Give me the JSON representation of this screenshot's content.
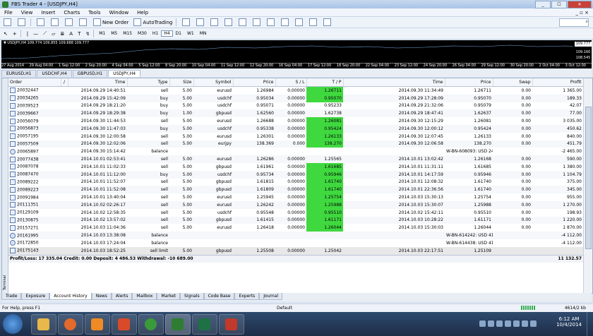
{
  "window": {
    "title": "FBS Trader 4 - [USDJPY,H4]",
    "controls": [
      "_",
      "☐",
      "✕"
    ]
  },
  "menu": {
    "items": [
      "File",
      "View",
      "Insert",
      "Charts",
      "Tools",
      "Window",
      "Help"
    ],
    "mdi_controls": "_ ▫ ×"
  },
  "toolbar1": {
    "new_order": "New Order",
    "autotrading": "AutoTrading"
  },
  "toolbar2": {
    "timeframes": [
      "M1",
      "M5",
      "M15",
      "M30",
      "H1",
      "H4",
      "D1",
      "W1",
      "MN"
    ],
    "active": "H4"
  },
  "search": {
    "icon": "search-icon"
  },
  "chart": {
    "header": "▼ USDJPY,H4  109.774  109.855  109.688  109.777",
    "price_top": "109.777",
    "price_mid": "109.160",
    "price_low": "108.545",
    "dates": [
      "27 Aug 2014",
      "29 Aug 04:00",
      "1 Sep 12:00",
      "2 Sep 20:00",
      "4 Sep 04:00",
      "5 Sep 12:00",
      "8 Sep 20:00",
      "10 Sep 04:00",
      "11 Sep 12:00",
      "12 Sep 20:00",
      "16 Sep 04:00",
      "17 Sep 12:00",
      "18 Sep 20:00",
      "22 Sep 04:00",
      "23 Sep 12:00",
      "24 Sep 20:00",
      "26 Sep 04:00",
      "29 Sep 12:00",
      "30 Sep 20:00",
      "2 Oct 04:00",
      "3 Oct 12:00"
    ]
  },
  "chart_tabs": [
    "EURUSD,H1",
    "USDCHF,H4",
    "GBPUSD,H1",
    "USDJPY,H4"
  ],
  "chart_tabs_active": 3,
  "table": {
    "headers": [
      "Order",
      "/",
      "Time",
      "Type",
      "Size",
      "Symbol",
      "Price",
      "S / L",
      "T / P",
      "Time",
      "Price",
      "Swap",
      "Profit"
    ],
    "rows": [
      [
        "20032447",
        "2014.09.29 14:40:51",
        "sell",
        "5.00",
        "eurusd",
        "1.26984",
        "0.00000",
        "1.26711",
        "2014.09.30 11:34:49",
        "1.26711",
        "0.00",
        "1 365.00",
        "tp"
      ],
      [
        "20034265",
        "2014.09.29 15:42:09",
        "buy",
        "5.00",
        "usdchf",
        "0.95034",
        "0.00000",
        "0.95070",
        "2014.09.29 17:28:09",
        "0.95070",
        "0.00",
        "189.33",
        "tp"
      ],
      [
        "20039523",
        "2014.09.29 18:21:20",
        "buy",
        "5.00",
        "usdchf",
        "0.95071",
        "0.00000",
        "0.95233",
        "2014.09.29 21:32:06",
        "0.95079",
        "0.00",
        "42.07",
        ""
      ],
      [
        "20039667",
        "2014.09.29 18:29:38",
        "buy",
        "1.00",
        "gbpusd",
        "1.62560",
        "0.00000",
        "1.62738",
        "2014.09.29 18:47:41",
        "1.62637",
        "0.00",
        "77.00",
        ""
      ],
      [
        "20056079",
        "2014.09.30 11:44:53",
        "sell",
        "5.00",
        "eurusd",
        "1.26688",
        "0.00000",
        "1.26081",
        "2014.09.30 12:15:29",
        "1.26081",
        "0.00",
        "3 035.00",
        "tp"
      ],
      [
        "20056873",
        "2014.09.30 11:47:03",
        "buy",
        "5.00",
        "usdchf",
        "0.95338",
        "0.00000",
        "0.95424",
        "2014.09.30 12:00:12",
        "0.95424",
        "0.00",
        "450.62",
        "tp"
      ],
      [
        "20057195",
        "2014.09.30 12:00:58",
        "sell",
        "5.00",
        "eurusd",
        "1.26301",
        "0.00000",
        "1.26133",
        "2014.09.30 12:07:45",
        "1.26133",
        "0.00",
        "840.00",
        "tp"
      ],
      [
        "20057509",
        "2014.09.30 12:02:06",
        "sell",
        "5.00",
        "eurjpy",
        "138.369",
        "0.000",
        "138.270",
        "2014.09.30 12:06:58",
        "138.270",
        "0.00",
        "451.79",
        "tp"
      ],
      [
        "20065897",
        "2014.09.30 15:14:42",
        "balance",
        "",
        "",
        "",
        "",
        "",
        "",
        "W-BN-608093: USD 24.65",
        "",
        "-2 465.00",
        "bal"
      ],
      [
        "20077438",
        "2014.10.01 02:53:41",
        "sell",
        "5.00",
        "eurusd",
        "1.26286",
        "0.00000",
        "1.25565",
        "2014.10.01 13:02:42",
        "1.26168",
        "0.00",
        "590.00",
        ""
      ],
      [
        "20087078",
        "2014.10.01 11:02:33",
        "sell",
        "5.00",
        "gbpusd",
        "1.61961",
        "0.00000",
        "1.61685",
        "2014.10.01 11:31:11",
        "1.61685",
        "0.00",
        "1 380.00",
        "tp"
      ],
      [
        "20087470",
        "2014.10.01 11:12:00",
        "buy",
        "5.00",
        "usdchf",
        "0.95734",
        "0.00000",
        "0.95946",
        "2014.10.01 14:17:59",
        "0.95946",
        "0.00",
        "1 104.79",
        "tp"
      ],
      [
        "20089222",
        "2014.10.01 11:52:07",
        "sell",
        "5.00",
        "gbpusd",
        "1.61815",
        "0.00000",
        "1.61740",
        "2014.10.01 12:08:32",
        "1.61740",
        "0.00",
        "375.00",
        "tp"
      ],
      [
        "20089223",
        "2014.10.01 11:52:08",
        "sell",
        "5.00",
        "gbpusd",
        "1.61809",
        "0.00000",
        "1.61740",
        "2014.10.01 22:36:56",
        "1.61740",
        "0.00",
        "345.00",
        "tp"
      ],
      [
        "20091984",
        "2014.10.01 13:40:04",
        "sell",
        "5.00",
        "eurusd",
        "1.25945",
        "0.00000",
        "1.25754",
        "2014.10.03 15:30:13",
        "1.25754",
        "0.00",
        "955.00",
        "tp"
      ],
      [
        "20111351",
        "2014.10.02 02:26:17",
        "sell",
        "5.00",
        "eurusd",
        "1.26242",
        "0.00000",
        "1.25988",
        "2014.10.03 15:30:07",
        "1.25988",
        "0.00",
        "1 270.00",
        "tp"
      ],
      [
        "20129109",
        "2014.10.02 12:58:35",
        "sell",
        "5.00",
        "usdchf",
        "0.95548",
        "0.00000",
        "0.95510",
        "2014.10.02 15:42:11",
        "0.95510",
        "0.00",
        "198.93",
        "tp"
      ],
      [
        "20130875",
        "2014.10.02 13:57:02",
        "sell",
        "5.00",
        "gbpusd",
        "1.61415",
        "0.00000",
        "1.61171",
        "2014.10.03 10:28:22",
        "1.61171",
        "0.00",
        "1 220.00",
        "tp"
      ],
      [
        "20157271",
        "2014.10.03 11:04:36",
        "sell",
        "5.00",
        "eurusd",
        "1.26418",
        "0.00000",
        "1.26044",
        "2014.10.03 15:30:03",
        "1.26044",
        "0.00",
        "1 870.00",
        "tp"
      ],
      [
        "20161995",
        "2014.10.03 13:38:08",
        "balance",
        "",
        "",
        "",
        "",
        "",
        "",
        "W-BN-614242: USD 41.12",
        "",
        "-4 112.00",
        "bal"
      ],
      [
        "20172850",
        "2014.10.03 17:24:04",
        "balance",
        "",
        "",
        "",
        "",
        "",
        "",
        "W-BN-614438: USD 41.12",
        "",
        "-4 112.00",
        "bal"
      ],
      [
        "20175143",
        "2014.10.03 18:52:25",
        "sell limit",
        "5.00",
        "gbpusd",
        "1.25508",
        "0.00000",
        "1.25042",
        "2014.10.03 22:17:51",
        "1.25109",
        "",
        "",
        "gray"
      ]
    ],
    "summary": "Profit/Loss: 17 335.04  Credit: 0.00  Deposit: 4 486.53  Withdrawal: -10 689.00",
    "summary_total": "11 132.57"
  },
  "terminal_label": "Terminal",
  "bottom_tabs": [
    "Trade",
    "Exposure",
    "Account History",
    "News",
    "Alerts",
    "Mailbox",
    "Market",
    "Signals",
    "Code Base",
    "Experts",
    "Journal"
  ],
  "bottom_tabs_active": 2,
  "status": {
    "help": "For Help, press F1",
    "profile": "Default",
    "traffic": "4614/2 kb"
  },
  "taskbar": {
    "time": "6:12 AM",
    "date": "10/4/2014"
  },
  "colors": {
    "tp_highlight": "#3fd93f",
    "chart_bg": "#000000",
    "title_bg": "#a9c4e6"
  }
}
